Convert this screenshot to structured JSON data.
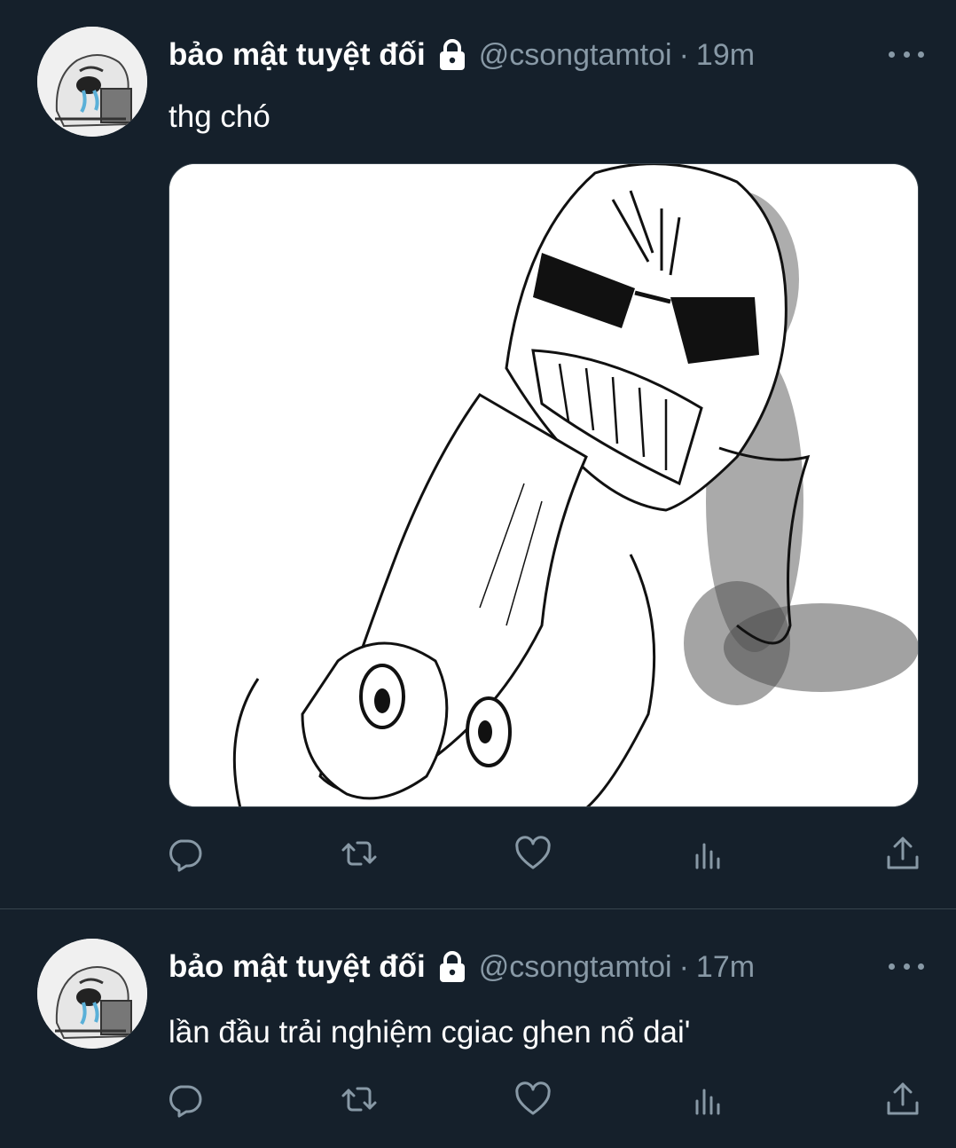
{
  "tweets": [
    {
      "name": "bảo mật tuyệt đối",
      "handle": "@csongtamtoi",
      "separator": "·",
      "time": "19m",
      "text": "thg chó",
      "has_media": true
    },
    {
      "name": "bảo mật tuyệt đối",
      "handle": "@csongtamtoi",
      "separator": "·",
      "time": "17m",
      "text": "lần đầu trải nghiệm cgiac ghen nổ dai'",
      "has_media": false
    }
  ],
  "icons": {
    "lock": "lock-icon",
    "more": "more-options-icon",
    "reply": "reply-icon",
    "retweet": "retweet-icon",
    "like": "like-icon",
    "analytics": "analytics-icon",
    "share": "share-icon"
  },
  "colors": {
    "background": "#15202b",
    "secondary_text": "#8899a6",
    "divider": "#38444d",
    "primary_text": "#ffffff"
  }
}
